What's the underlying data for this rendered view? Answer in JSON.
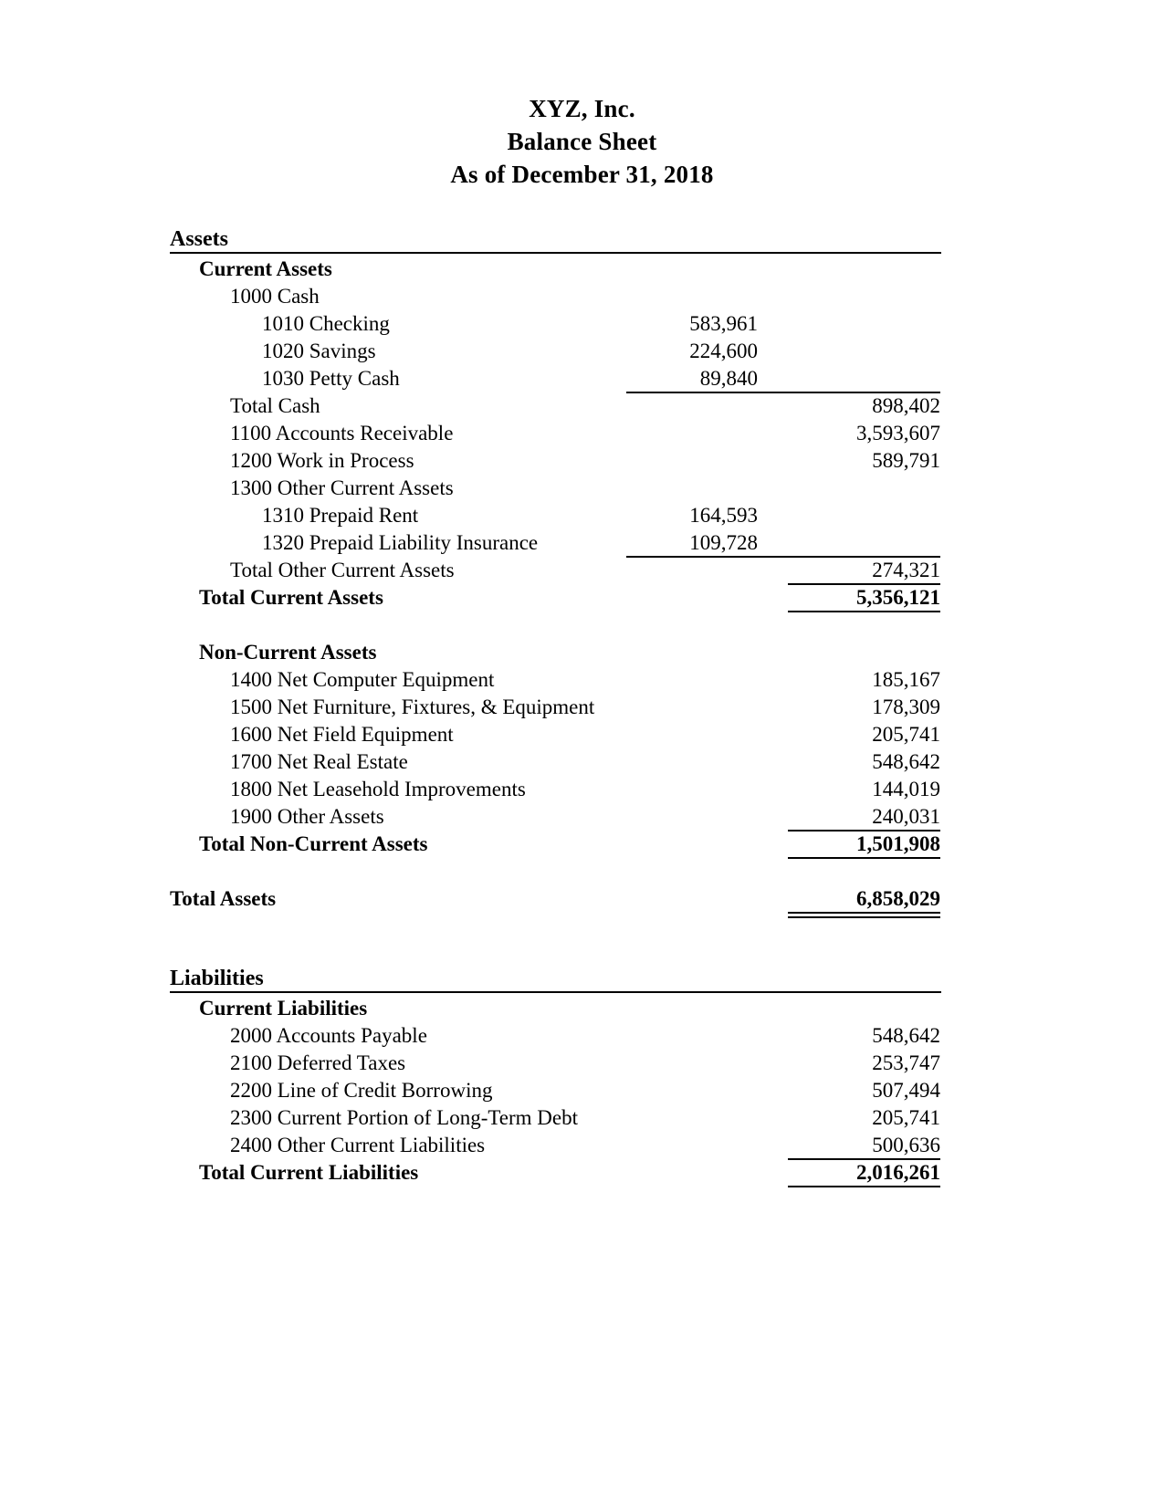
{
  "document": {
    "company": "XYZ, Inc.",
    "statement": "Balance Sheet",
    "period": "As of December 31, 2018"
  },
  "sections": [
    {
      "header": "Assets",
      "groups": [
        {
          "title": "Current Assets",
          "lines": [
            {
              "label": "1000 Cash",
              "col1": "",
              "col2": ""
            },
            {
              "label": "1010 Checking",
              "col1": "583,961",
              "col2": ""
            },
            {
              "label": "1020 Savings",
              "col1": "224,600",
              "col2": ""
            },
            {
              "label": "1030 Petty Cash",
              "col1": "89,840",
              "col2": ""
            },
            {
              "label": "Total Cash",
              "col1": "",
              "col2": "898,402"
            },
            {
              "label": "1100 Accounts Receivable",
              "col1": "",
              "col2": "3,593,607"
            },
            {
              "label": "1200 Work in Process",
              "col1": "",
              "col2": "589,791"
            },
            {
              "label": "1300 Other Current Assets",
              "col1": "",
              "col2": ""
            },
            {
              "label": "1310 Prepaid Rent",
              "col1": "164,593",
              "col2": ""
            },
            {
              "label": "1320 Prepaid Liability Insurance",
              "col1": "109,728",
              "col2": ""
            },
            {
              "label": "Total Other Current Assets",
              "col1": "",
              "col2": "274,321"
            },
            {
              "label": "Total Current Assets",
              "col1": "",
              "col2": "5,356,121"
            }
          ]
        },
        {
          "title": "Non-Current Assets",
          "lines": [
            {
              "label": "1400 Net Computer Equipment",
              "col1": "",
              "col2": "185,167"
            },
            {
              "label": "1500 Net Furniture, Fixtures, & Equipment",
              "col1": "",
              "col2": "178,309"
            },
            {
              "label": "1600 Net Field Equipment",
              "col1": "",
              "col2": "205,741"
            },
            {
              "label": "1700 Net Real Estate",
              "col1": "",
              "col2": "548,642"
            },
            {
              "label": "1800 Net Leasehold Improvements",
              "col1": "",
              "col2": "144,019"
            },
            {
              "label": "1900 Other Assets",
              "col1": "",
              "col2": "240,031"
            },
            {
              "label": "Total Non-Current Assets",
              "col1": "",
              "col2": "1,501,908"
            }
          ]
        }
      ],
      "grand_total": {
        "label": "Total Assets",
        "value": "6,858,029"
      }
    },
    {
      "header": "Liabilities",
      "groups": [
        {
          "title": "Current Liabilities",
          "lines": [
            {
              "label": "2000 Accounts Payable",
              "col1": "",
              "col2": "548,642"
            },
            {
              "label": "2100 Deferred Taxes",
              "col1": "",
              "col2": "253,747"
            },
            {
              "label": "2200 Line of Credit Borrowing",
              "col1": "",
              "col2": "507,494"
            },
            {
              "label": "2300 Current Portion of Long-Term Debt",
              "col1": "",
              "col2": "205,741"
            },
            {
              "label": "2400 Other Current Liabilities",
              "col1": "",
              "col2": "500,636"
            },
            {
              "label": "Total Current Liabilities",
              "col1": "",
              "col2": "2,016,261"
            }
          ]
        }
      ]
    }
  ]
}
